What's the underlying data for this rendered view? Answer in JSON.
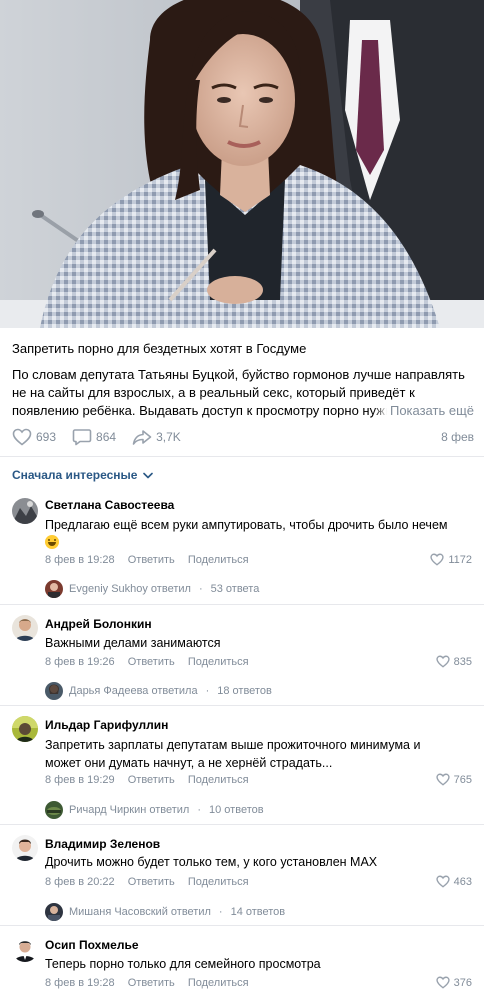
{
  "post": {
    "photo_icon": "news-photo",
    "title": "Запретить порно для бездетных хотят в Госдуме",
    "body_lines": [
      "По словам депутата Татьяны Буцкой, буйство гормонов лучше направлять",
      "не на сайты для взрослых, а в реальный секс, который приведёт к",
      "появлению ребёнка. Выдавать доступ к просмотру порно нуж"
    ],
    "body_fade": "но",
    "show_more": "Показать ещё",
    "likes": "693",
    "comments": "864",
    "reposts": "3,7K",
    "date": "8 фев"
  },
  "sort": {
    "label": "Сначала интересные"
  },
  "comments": [
    {
      "author": "Светлана Савостеева",
      "text": "Предлагаю ещё всем руки ампутировать, чтобы дрочить было нечем",
      "time": "8 фев в 19:28",
      "reply_label": "Ответить",
      "share_label": "Поделиться",
      "likes": "1172",
      "replies_author": "Evgeniy Sukhoy ответил",
      "replies_count": "53 ответа"
    },
    {
      "author": "Андрей Болонкин",
      "text": "Важными делами занимаются",
      "time": "8 фев в 19:26",
      "reply_label": "Ответить",
      "share_label": "Поделиться",
      "likes": "835",
      "replies_author": "Дарья Фадеева ответила",
      "replies_count": "18 ответов"
    },
    {
      "author": "Ильдар Гарифуллин",
      "text": "Запретить зарплаты депутатам выше прожиточного минимума и может они думать начнут, а не хернёй страдать...",
      "time": "8 фев в 19:29",
      "reply_label": "Ответить",
      "share_label": "Поделиться",
      "likes": "765",
      "replies_author": "Ричард Чиркин ответил",
      "replies_count": "10 ответов"
    },
    {
      "author": "Владимир Зеленов",
      "text": "Дрочить можно будет только тем, у кого установлен MAX",
      "time": "8 фев в 20:22",
      "reply_label": "Ответить",
      "share_label": "Поделиться",
      "likes": "463",
      "replies_author": "Мишаня Часовский ответил",
      "replies_count": "14 ответов"
    },
    {
      "author": "Осип Похмелье",
      "text": "Теперь порно только для семейного просмотра",
      "time": "8 фев в 19:28",
      "reply_label": "Ответить",
      "share_label": "Поделиться",
      "likes": "376"
    }
  ],
  "colors": {
    "link": "#2a5885",
    "secondary": "#818c99",
    "divider": "#e7e8ec"
  }
}
